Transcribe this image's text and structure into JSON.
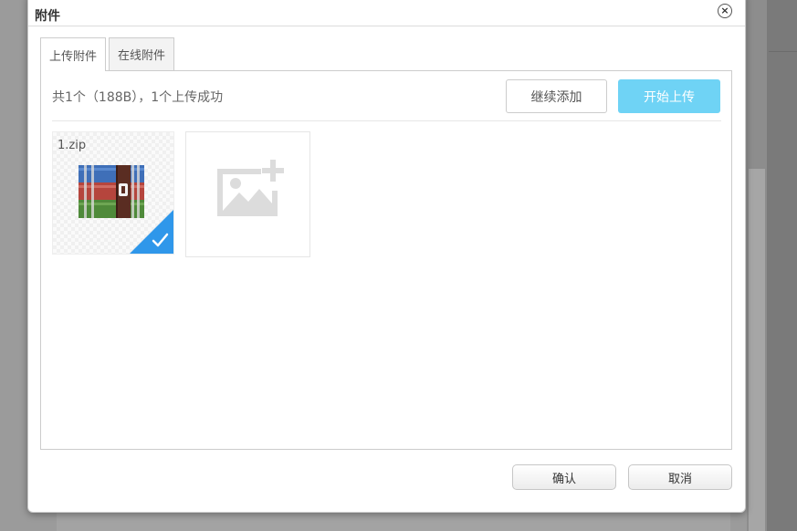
{
  "dialog": {
    "title": "附件",
    "close_symbol": "×"
  },
  "tabs": [
    {
      "label": "上传附件",
      "active": true
    },
    {
      "label": "在线附件",
      "active": false
    }
  ],
  "upload": {
    "status_text": "共1个（188B），1个上传成功",
    "continue_label": "继续添加",
    "start_label": "开始上传",
    "files": [
      {
        "name": "1.zip",
        "icon": "winrar-archive-icon",
        "uploaded": true
      }
    ],
    "add_placeholder_icon": "add-image-icon"
  },
  "footer": {
    "confirm_label": "确认",
    "cancel_label": "取消"
  },
  "colors": {
    "start_button": "#6fd3f5",
    "success_check": "#2f97ea"
  }
}
